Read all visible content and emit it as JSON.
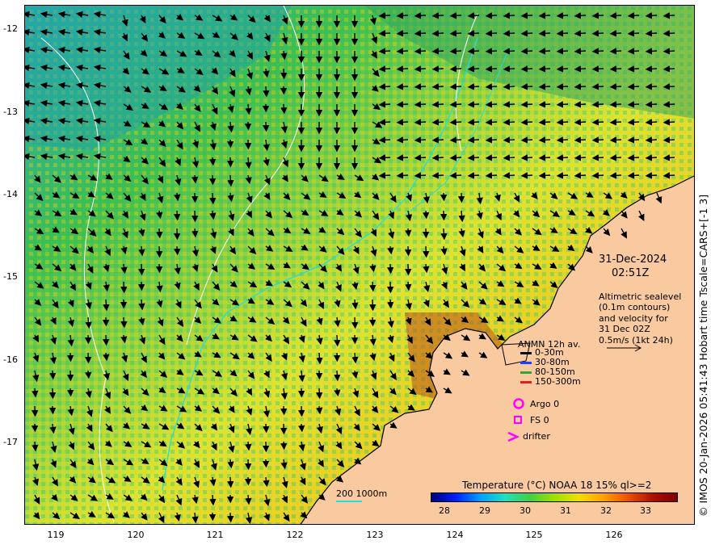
{
  "map": {
    "lat_ticks": [
      "-12",
      "-13",
      "-14",
      "-15",
      "-16",
      "-17"
    ],
    "lon_ticks": [
      "119",
      "120",
      "121",
      "122",
      "123",
      "124",
      "125",
      "126"
    ]
  },
  "annotation": {
    "date": "31-Dec-2024",
    "time": "02:51Z",
    "altimetry_lines": [
      "Altimetric sealevel",
      "(0.1m contours)",
      "and velocity for",
      "31 Dec 02Z",
      "0.5m/s (1kt 24h)"
    ]
  },
  "anmn_legend": {
    "title": "ANMN 12h av.",
    "items": [
      {
        "label": "0-30m",
        "color": "#000000"
      },
      {
        "label": "30-80m",
        "color": "#1d3cff"
      },
      {
        "label": "80-150m",
        "color": "#2faa2f"
      },
      {
        "label": "150-300m",
        "color": "#e0201a"
      }
    ]
  },
  "markers": {
    "argo": "Argo 0",
    "fs": "FS 0",
    "drifter": "drifter"
  },
  "colorbar": {
    "title": "Temperature (°C) NOAA 18 15% ql>=2",
    "ticks": [
      "28",
      "29",
      "30",
      "31",
      "32",
      "33"
    ]
  },
  "bathymetry_label": "200  1000m",
  "credit": "© IMOS 20-Jan-2026 05:41:43 Hobart time Tscale=CARS+[-1 3]",
  "colors": {
    "land": "#f9c9a0",
    "coast": "#000000",
    "contour": "#ffffff",
    "isobath": "#22dddd",
    "marker": "#ff00ff"
  }
}
